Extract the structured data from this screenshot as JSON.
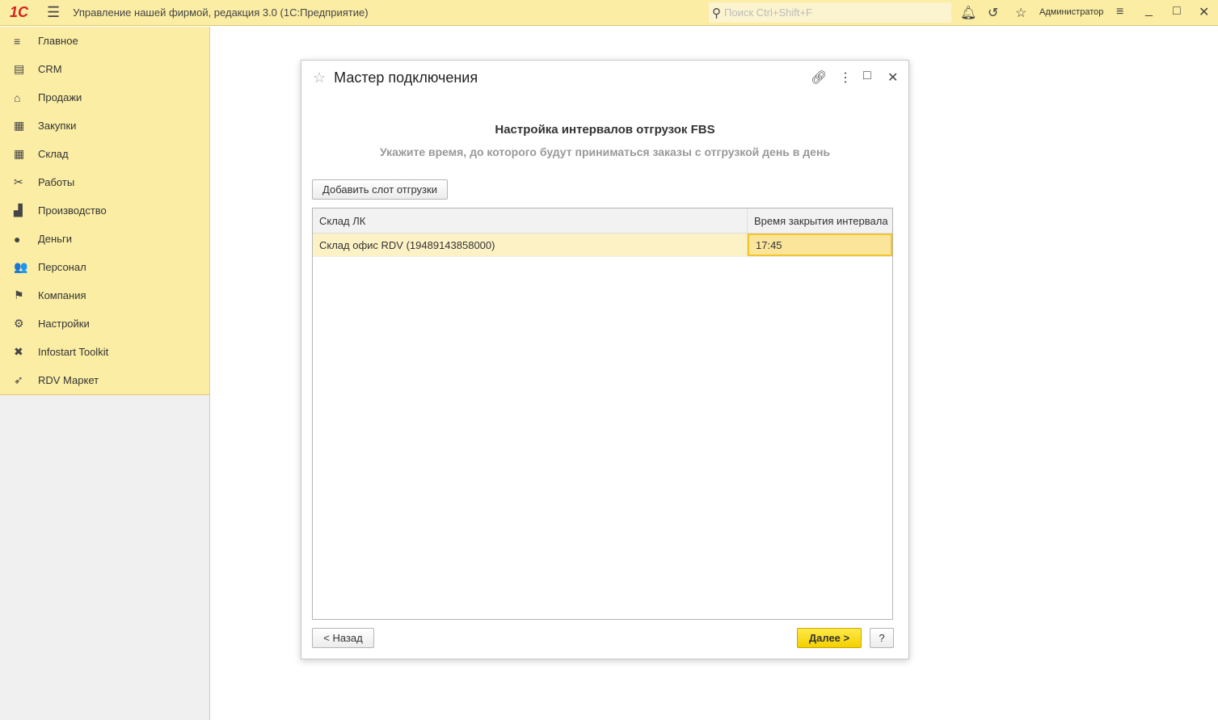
{
  "topbar": {
    "logo": "1С",
    "title": "Управление нашей фирмой, редакция 3.0  (1С:Предприятие)",
    "search_placeholder": "Поиск Ctrl+Shift+F",
    "user": "Администратор"
  },
  "sidebar": {
    "items": [
      {
        "label": "Главное",
        "icon": "≡"
      },
      {
        "label": "CRM",
        "icon": "▤"
      },
      {
        "label": "Продажи",
        "icon": "⌂"
      },
      {
        "label": "Закупки",
        "icon": "▦"
      },
      {
        "label": "Склад",
        "icon": "▦"
      },
      {
        "label": "Работы",
        "icon": "✂"
      },
      {
        "label": "Производство",
        "icon": "▟"
      },
      {
        "label": "Деньги",
        "icon": "●"
      },
      {
        "label": "Персонал",
        "icon": "👥"
      },
      {
        "label": "Компания",
        "icon": "⚑"
      },
      {
        "label": "Настройки",
        "icon": "⚙"
      },
      {
        "label": "Infostart Toolkit",
        "icon": "✖"
      },
      {
        "label": "RDV Маркет",
        "icon": "➶"
      }
    ]
  },
  "dialog": {
    "title": "Мастер подключения",
    "heading": "Настройка интервалов отгрузок FBS",
    "subheading": "Укажите время, до которого будут приниматься заказы с отгрузкой день в день",
    "add_button": "Добавить слот отгрузки",
    "columns": [
      "Склад ЛК",
      "Время закрытия интервала"
    ],
    "rows": [
      {
        "warehouse": "Склад офис RDV (19489143858000)",
        "time": "17:45"
      }
    ],
    "back_button": "< Назад",
    "next_button": "Далее >",
    "help_button": "?"
  }
}
